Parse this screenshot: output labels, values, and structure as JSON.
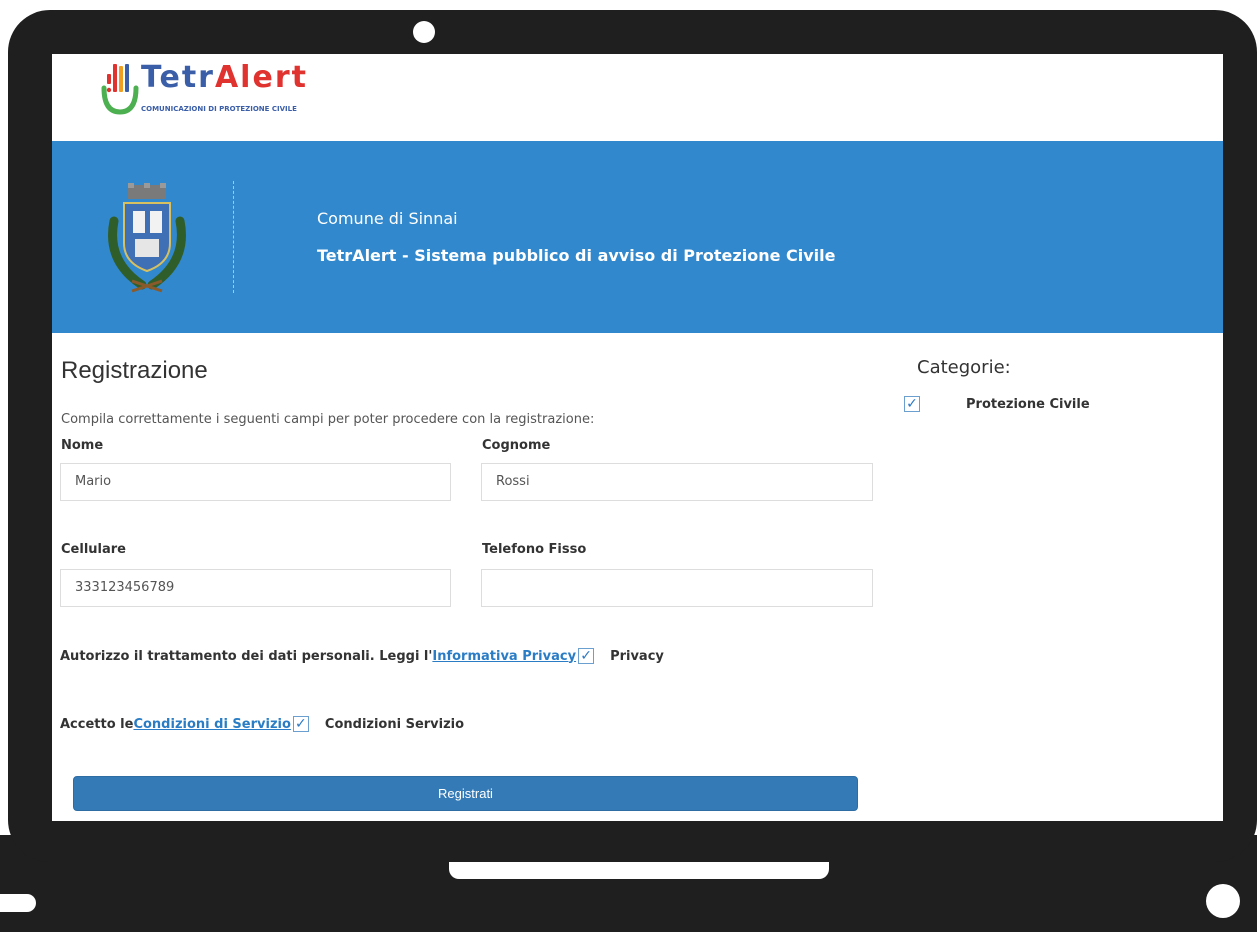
{
  "logo": {
    "word_part1": "Tetr",
    "word_part2": "Alert",
    "subtitle": "COMUNICAZIONI DI PROTEZIONE CIVILE",
    "color_part1": "#3a5ea8",
    "color_part2": "#e0322f"
  },
  "banner": {
    "line1": "Comune di Sinnai",
    "line2": "TetrAlert - Sistema pubblico di avviso di Protezione Civile",
    "background": "#3288cc",
    "crest_icon": "municipal-crest-icon"
  },
  "form": {
    "title": "Registrazione",
    "intro": "Compila correttamente i seguenti campi per poter procedere con la registrazione:",
    "fields": [
      {
        "label": "Nome",
        "value": "Mario"
      },
      {
        "label": "Cognome",
        "value": "Rossi"
      },
      {
        "label": "Cellulare",
        "value": "333123456789"
      },
      {
        "label": "Telefono Fisso",
        "value": ""
      }
    ],
    "privacy": {
      "prefix": "Autorizzo il trattamento dei dati personali. Leggi l'",
      "link": "Informativa Privacy",
      "checked": true,
      "check_glyph": "✓",
      "tail": "Privacy"
    },
    "terms": {
      "prefix": "Accetto le ",
      "link": "Condizioni di Servizio",
      "checked": true,
      "check_glyph": "✓",
      "tail": "Condizioni Servizio"
    },
    "submit_label": "Registrati"
  },
  "categories": {
    "title": "Categorie:",
    "items": [
      {
        "label": "Protezione Civile",
        "checked": true,
        "check_glyph": "✓"
      }
    ]
  },
  "colors": {
    "accent": "#337ab7",
    "link": "#2a7dc5",
    "device": "#1f1f1f"
  }
}
